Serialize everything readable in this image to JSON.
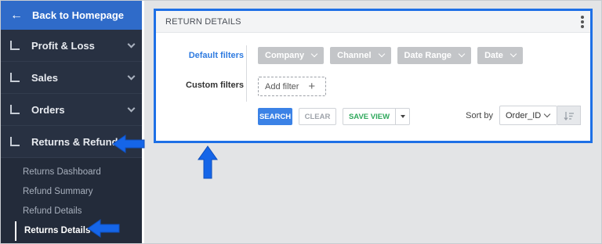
{
  "sidebar": {
    "back_label": "Back to Homepage",
    "items": [
      {
        "label": "Profit & Loss"
      },
      {
        "label": "Sales"
      },
      {
        "label": "Orders"
      },
      {
        "label": "Returns & Refunds"
      }
    ],
    "subitems": [
      {
        "label": "Returns Dashboard"
      },
      {
        "label": "Refund Summary"
      },
      {
        "label": "Refund Details"
      },
      {
        "label": "Returns Details"
      }
    ],
    "active_subitem": "Returns Details"
  },
  "card": {
    "title": "RETURN DETAILS",
    "default_filters_label": "Default filters",
    "custom_filters_label": "Custom filters",
    "chips": [
      {
        "label": "Company"
      },
      {
        "label": "Channel"
      },
      {
        "label": "Date Range"
      },
      {
        "label": "Date"
      }
    ],
    "add_filter_label": "Add filter",
    "search_label": "SEARCH",
    "clear_label": "CLEAR",
    "save_view_label": "SAVE VIEW",
    "sort_by_label": "Sort by",
    "sort_value": "Order_ID"
  },
  "colors": {
    "sidebar_bg": "#283142",
    "back_bg": "#2f6bc9",
    "highlight_border": "#1e70e6",
    "search_btn": "#3b82e6",
    "save_view_text": "#2ea85b",
    "annotation_arrow": "#1565e8"
  },
  "icons": {
    "back": "arrow-left-icon",
    "nav": "bar-chart-icon",
    "chevron": "chevron-down-icon",
    "menu": "kebab-menu-icon",
    "plus": "plus-icon",
    "sort_dir": "sort-descending-icon"
  }
}
